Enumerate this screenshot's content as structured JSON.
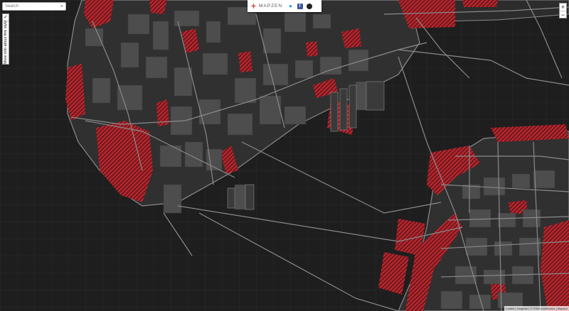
{
  "search": {
    "placeholder": "Search"
  },
  "info_panel": {
    "checkmark": "✓",
    "label": "More info about this style"
  },
  "header": {
    "brand": "MAPZEN",
    "share_buttons": [
      {
        "icon": "twitter-icon"
      },
      {
        "icon": "facebook-icon",
        "glyph": "f"
      },
      {
        "icon": "github-icon"
      }
    ]
  },
  "zoom": {
    "in_label": "+",
    "out_label": "−"
  },
  "attribution": {
    "text": "Leaflet | Tangram | © OSM contributors | Mapzen"
  },
  "colors": {
    "background": "#1e1e1e",
    "water": "#242424",
    "land": "#333333",
    "parks": "#e8323c",
    "roads": "#8a8a8a",
    "buildings": "#4a4a4a"
  }
}
